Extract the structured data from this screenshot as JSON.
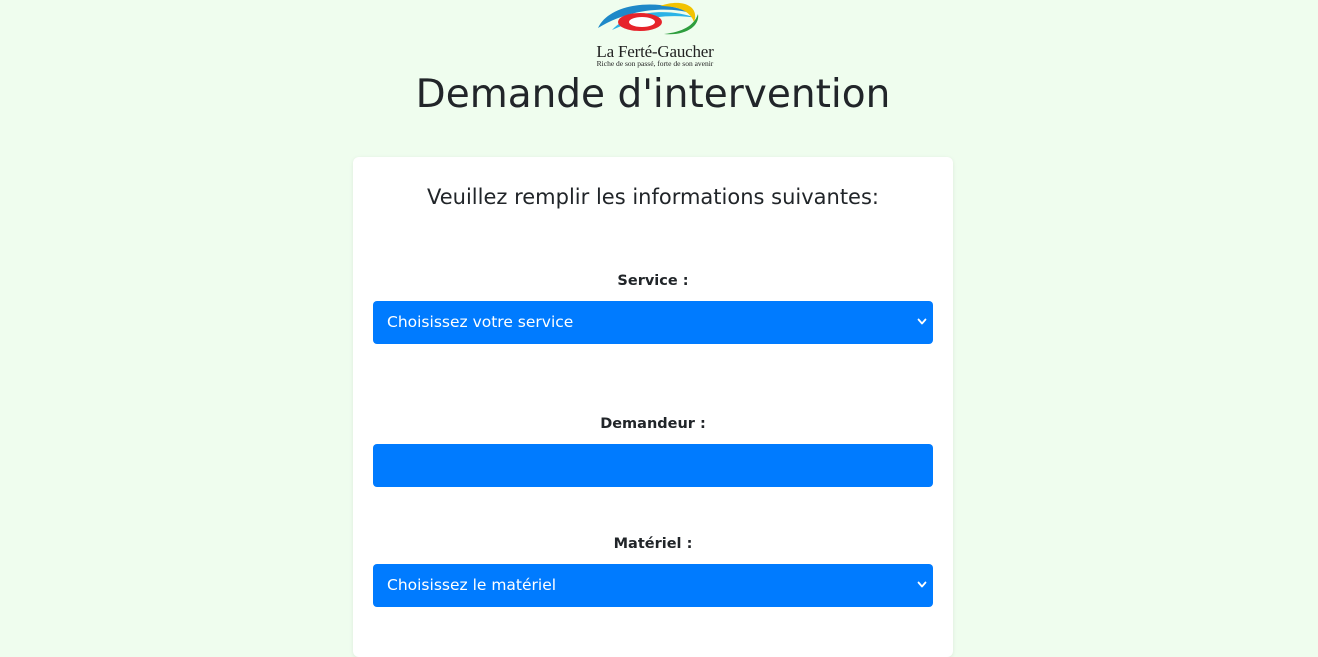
{
  "logo": {
    "name": "La Ferté-Gaucher",
    "tagline": "Riche de son passé, forte de son avenir"
  },
  "page_title": "Demande d'intervention",
  "form": {
    "subtitle": "Veuillez remplir les informations suivantes:",
    "service": {
      "label": "Service :",
      "selected": "Choisissez votre service"
    },
    "demandeur": {
      "label": "Demandeur :",
      "value": ""
    },
    "materiel": {
      "label": "Matériel :",
      "selected": "Choisissez le matériel"
    }
  },
  "colors": {
    "page_background": "#effdee",
    "control_background": "#007bff",
    "card_background": "#ffffff"
  }
}
